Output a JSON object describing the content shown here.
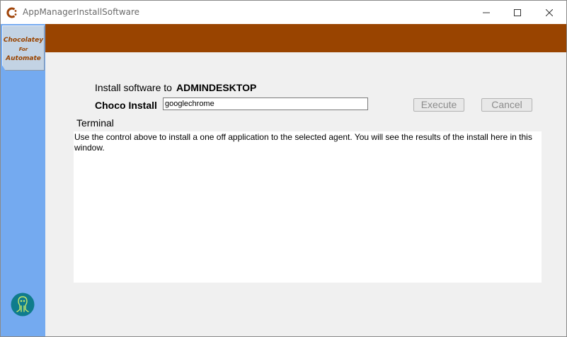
{
  "window": {
    "title": "AppManagerInstallSoftware"
  },
  "sidebar": {
    "logo_lines": [
      "Chocolatey",
      "For",
      "Automate"
    ],
    "bottom_icon": "octopus-robot-icon"
  },
  "form": {
    "install_label": "Install software to",
    "machine_name": "ADMINDESKTOP",
    "choco_label": "Choco Install",
    "choco_value": "googlechrome",
    "execute_label": "Execute",
    "cancel_label": "Cancel",
    "terminal_label": "Terminal",
    "terminal_text": "Use the control above to install a one off application to the selected agent. You will see the results of the install here in this window."
  },
  "colors": {
    "banner": "#994400",
    "sidebar": "#74aaf0",
    "logo_bg": "#c3d3e4",
    "window_bg": "#f0f0f0"
  }
}
